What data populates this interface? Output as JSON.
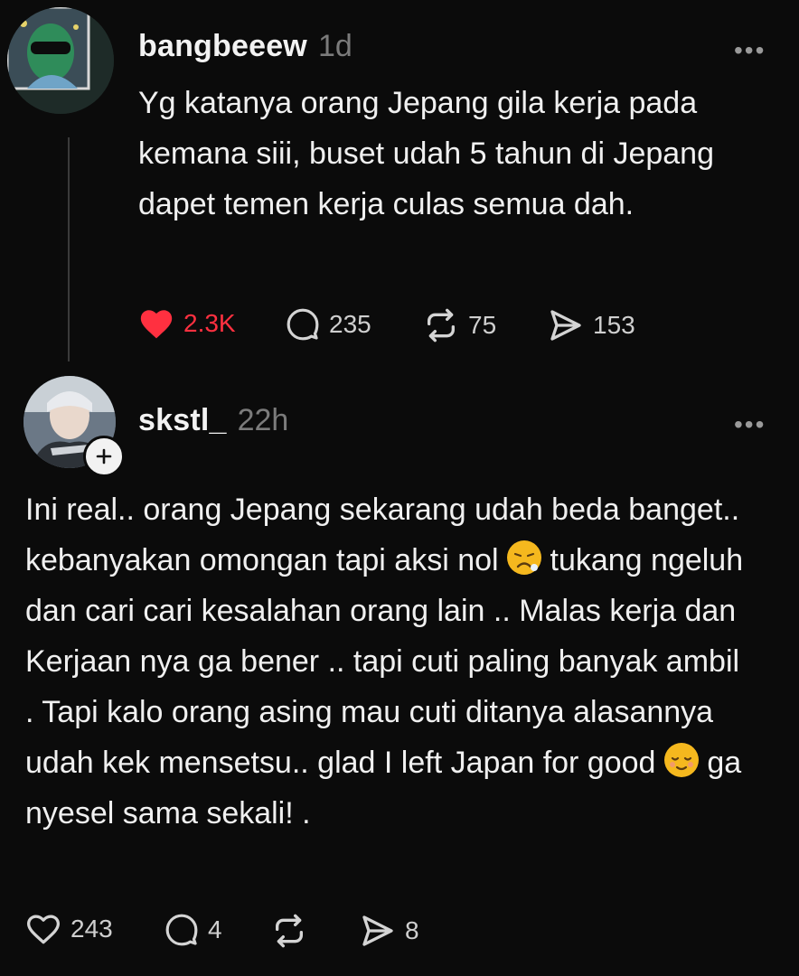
{
  "posts": [
    {
      "username": "bangbeeew",
      "time": "1d",
      "more": "•••",
      "text": "Yg katanya orang Jepang gila kerja pada kemana siii, buset udah 5 tahun di Jepang dapet temen kerja culas semua dah.",
      "likes": "2.3K",
      "comments": "235",
      "reposts": "75",
      "shares": "153",
      "liked": true,
      "accent_liked": "#ff3040"
    },
    {
      "username": "skstl_",
      "time": "22h",
      "more": "•••",
      "text_parts": {
        "p1": "Ini real.. orang Jepang sekarang udah beda banget.. kebanyakan omongan tapi aksi nol",
        "emoji1": "tired-face-emoji",
        "p2": " tukang ngeluh dan cari cari kesalahan orang lain .. Malas kerja dan Kerjaan nya ga bener .. tapi cuti paling banyak ambil . Tapi kalo orang asing mau cuti ditanya alasannya udah kek mensetsu.. glad I left Japan for good ",
        "emoji2": "relieved-face-emoji",
        "p3": " ga nyesel sama sekali! ."
      },
      "likes": "243",
      "comments": "4",
      "reposts": "",
      "shares": "8",
      "follow_icon": "plus-icon"
    }
  ]
}
